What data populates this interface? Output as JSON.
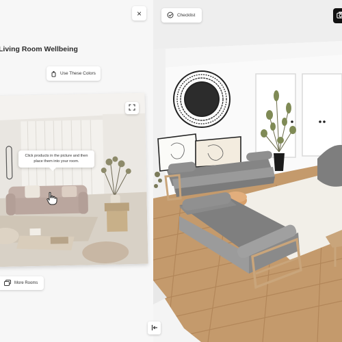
{
  "panel": {
    "title": "Living Room Wellbeing",
    "close_label": "×",
    "colors_button": "Use These Colors",
    "tooltip": "Click products in the picture and then place them into your room.",
    "more_rooms_button": "More Rooms"
  },
  "toolbar": {
    "checklist_button": "Checklist"
  },
  "icons": {
    "close": "close-icon",
    "colors": "paint-bucket-icon",
    "expand": "expand-icon",
    "hand": "hand-pointer-icon",
    "more_rooms": "gallery-icon",
    "collapse": "collapse-panel-icon",
    "checklist": "checklist-icon",
    "camera": "camera-icon"
  },
  "colors": {
    "panel_bg": "#f7f7f7",
    "sofa_gray": "#8a8a8a",
    "wood": "#c9a57b",
    "rug": "#f2efe8"
  }
}
